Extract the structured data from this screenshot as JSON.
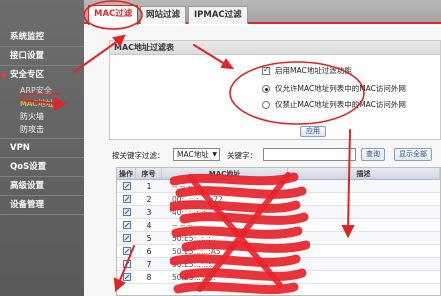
{
  "sidebar": {
    "items": [
      {
        "label": "系统监控"
      },
      {
        "label": "接口设置"
      },
      {
        "label": "安全专区",
        "expanded": true,
        "subs": [
          {
            "label": "ARP安全"
          },
          {
            "label": "MAC地址"
          },
          {
            "label": "防火墙"
          },
          {
            "label": "防攻击"
          }
        ]
      },
      {
        "label": "VPN"
      },
      {
        "label": "QoS设置"
      },
      {
        "label": "高级设置"
      },
      {
        "label": "设备管理"
      }
    ]
  },
  "tabs": [
    {
      "label": "MAC过滤",
      "active": true
    },
    {
      "label": "网站过滤"
    },
    {
      "label": "IPMAC过滤"
    }
  ],
  "panel": {
    "title": "MAC地址过滤表",
    "enable_label": "启用MAC地址过滤功能",
    "allow_label": "仅允许MAC地址列表中的MAC访问外网",
    "deny_label": "仅禁止MAC地址列表中的MAC访问外网",
    "apply_label": "应用"
  },
  "search": {
    "filter_label": "按关键字过滤：",
    "filter_select": "MAC地址",
    "keyword_label": "关键字：",
    "keyword_value": "",
    "query_label": "查询",
    "show_all_label": "显示全部"
  },
  "table": {
    "headers": [
      "操作",
      "序号",
      "MAC地址",
      "描述"
    ],
    "rows": [
      {
        "no": "1",
        "mac": "-- -- --"
      },
      {
        "no": "2",
        "mac": "00:..:..:..:..:72"
      },
      {
        "no": "3",
        "mac": "40:..:..:..:.."
      },
      {
        "no": "4",
        "mac": "-- -- --"
      },
      {
        "no": "5",
        "mac": "50:E5:..:..:.."
      },
      {
        "no": "6",
        "mac": "50:E5:..:..:A5"
      },
      {
        "no": "7",
        "mac": "50:E5:..:..:.."
      },
      {
        "no": "8",
        "mac": "50:E5:..:..:.."
      }
    ]
  },
  "colors": {
    "accent": "#d92b2b",
    "sidebar_bg": "#636363",
    "link": "#2b4a8a"
  }
}
